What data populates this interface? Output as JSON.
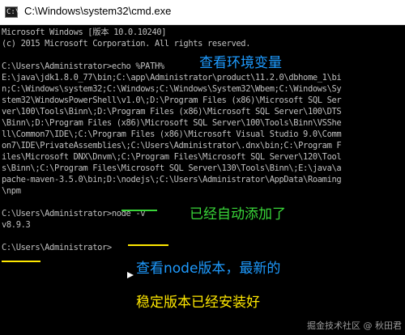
{
  "window": {
    "title": "C:\\Windows\\system32\\cmd.exe",
    "icon_text": "C:\\"
  },
  "console": {
    "lines": [
      "Microsoft Windows [版本 10.0.10240]",
      "(c) 2015 Microsoft Corporation. All rights reserved.",
      "",
      "C:\\Users\\Administrator>echo %PATH%",
      "E:\\java\\jdk1.8.0_77\\bin;C:\\app\\Administrator\\product\\11.2.0\\dbhome_1\\bi",
      "n;C:\\Windows\\system32;C:\\Windows;C:\\Windows\\System32\\Wbem;C:\\Windows\\Sy",
      "stem32\\WindowsPowerShell\\v1.0\\;D:\\Program Files (x86)\\Microsoft SQL Ser",
      "ver\\100\\Tools\\Binn\\;D:\\Program Files (x86)\\Microsoft SQL Server\\100\\DTS",
      "\\Binn\\;D:\\Program Files (x86)\\Microsoft SQL Server\\100\\Tools\\Binn\\VSShe",
      "ll\\Common7\\IDE\\;C:\\Program Files (x86)\\Microsoft Visual Studio 9.0\\Comm",
      "on7\\IDE\\PrivateAssemblies\\;C:\\Users\\Administrator\\.dnx\\bin;C:\\Program F",
      "iles\\Microsoft DNX\\Dnvm\\;C:\\Program Files\\Microsoft SQL Server\\120\\Tool",
      "s\\Binn\\;C:\\Program Files\\Microsoft SQL Server\\130\\Tools\\Binn\\;E:\\java\\a",
      "pache-maven-3.5.0\\bin;D:\\nodejs\\;C:\\Users\\Administrator\\AppData\\Roaming",
      "\\npm",
      "",
      "C:\\Users\\Administrator>node -v",
      "v8.9.3",
      "",
      "C:\\Users\\Administrator>"
    ]
  },
  "annotations": {
    "view_path": "查看环境变量",
    "auto_added": "已经自动添加了",
    "node_version_line1": "查看node版本，最新的",
    "node_version_line2": "稳定版本已经安装好"
  },
  "watermark": "掘金技术社区 @ 秋田君",
  "colors": {
    "console_text": "#c0c0c0",
    "annotation_blue": "#1e9bff",
    "annotation_green": "#39d639",
    "annotation_yellow": "#ffe800"
  }
}
